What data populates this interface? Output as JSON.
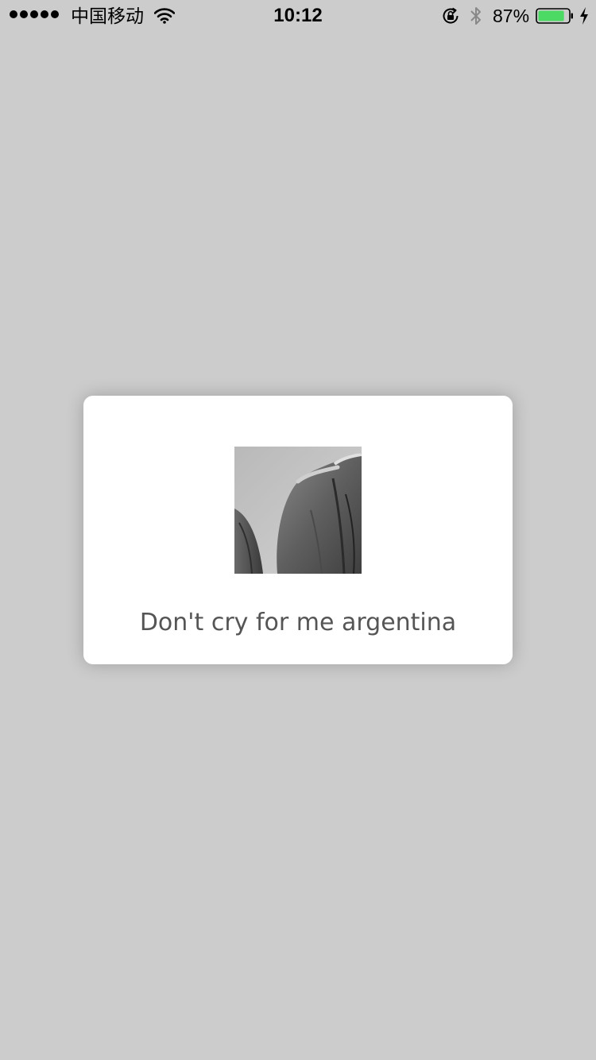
{
  "status_bar": {
    "carrier": "中国移动",
    "time": "10:12",
    "battery_percent": "87%",
    "battery_level": 0.87,
    "signal_bars": 5,
    "icons": [
      "signal-dots",
      "wifi-icon",
      "rotation-lock-icon",
      "bluetooth-icon",
      "battery-icon",
      "charging-icon"
    ]
  },
  "toast": {
    "image_icon": "photo-thumbnail",
    "message": "Don't cry for me argentina"
  },
  "colors": {
    "background": "#cccccc",
    "card": "#ffffff",
    "message_text": "#555555",
    "battery_fill": "#4cd964"
  }
}
